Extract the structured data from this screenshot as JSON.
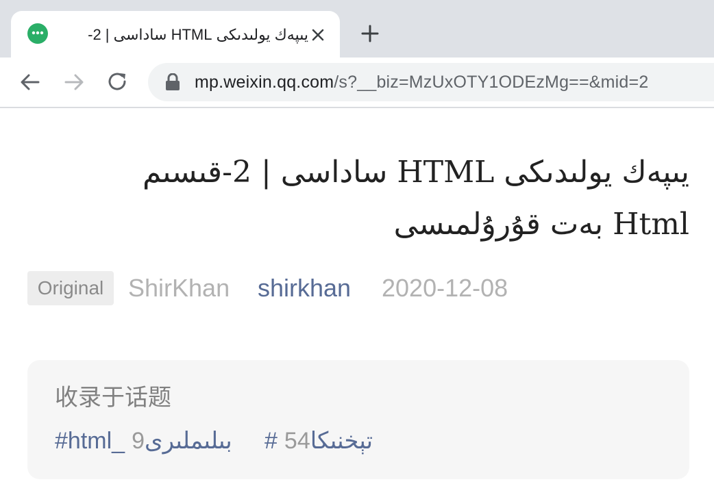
{
  "browser": {
    "tab": {
      "title": "يىپەك يولىدىكى HTML ساداسى | 2-",
      "favicon": "wechat-icon"
    },
    "omnibox": {
      "url_host": "mp.weixin.qq.com",
      "url_path": "/s?__biz=MzUxOTY1ODEzMg==&mid=2"
    }
  },
  "article": {
    "title": "يىپەك يولىدىكى HTML ساداسى | 2-قىسىم Html بەت قۇرۇلمىسى",
    "meta": {
      "original_tag": "Original",
      "author": "ShirKhan",
      "account": "shirkhan",
      "date": "2020-12-08"
    },
    "topics": {
      "label": "收录于话题",
      "items": [
        {
          "name": "#html_بىلىملىرى",
          "count": "9"
        },
        {
          "name": "#تېخنىكا",
          "count": "54"
        }
      ]
    }
  },
  "colors": {
    "link": "#576b95",
    "wechat_green": "#2aae67",
    "tabstrip_bg": "#dee1e6"
  }
}
